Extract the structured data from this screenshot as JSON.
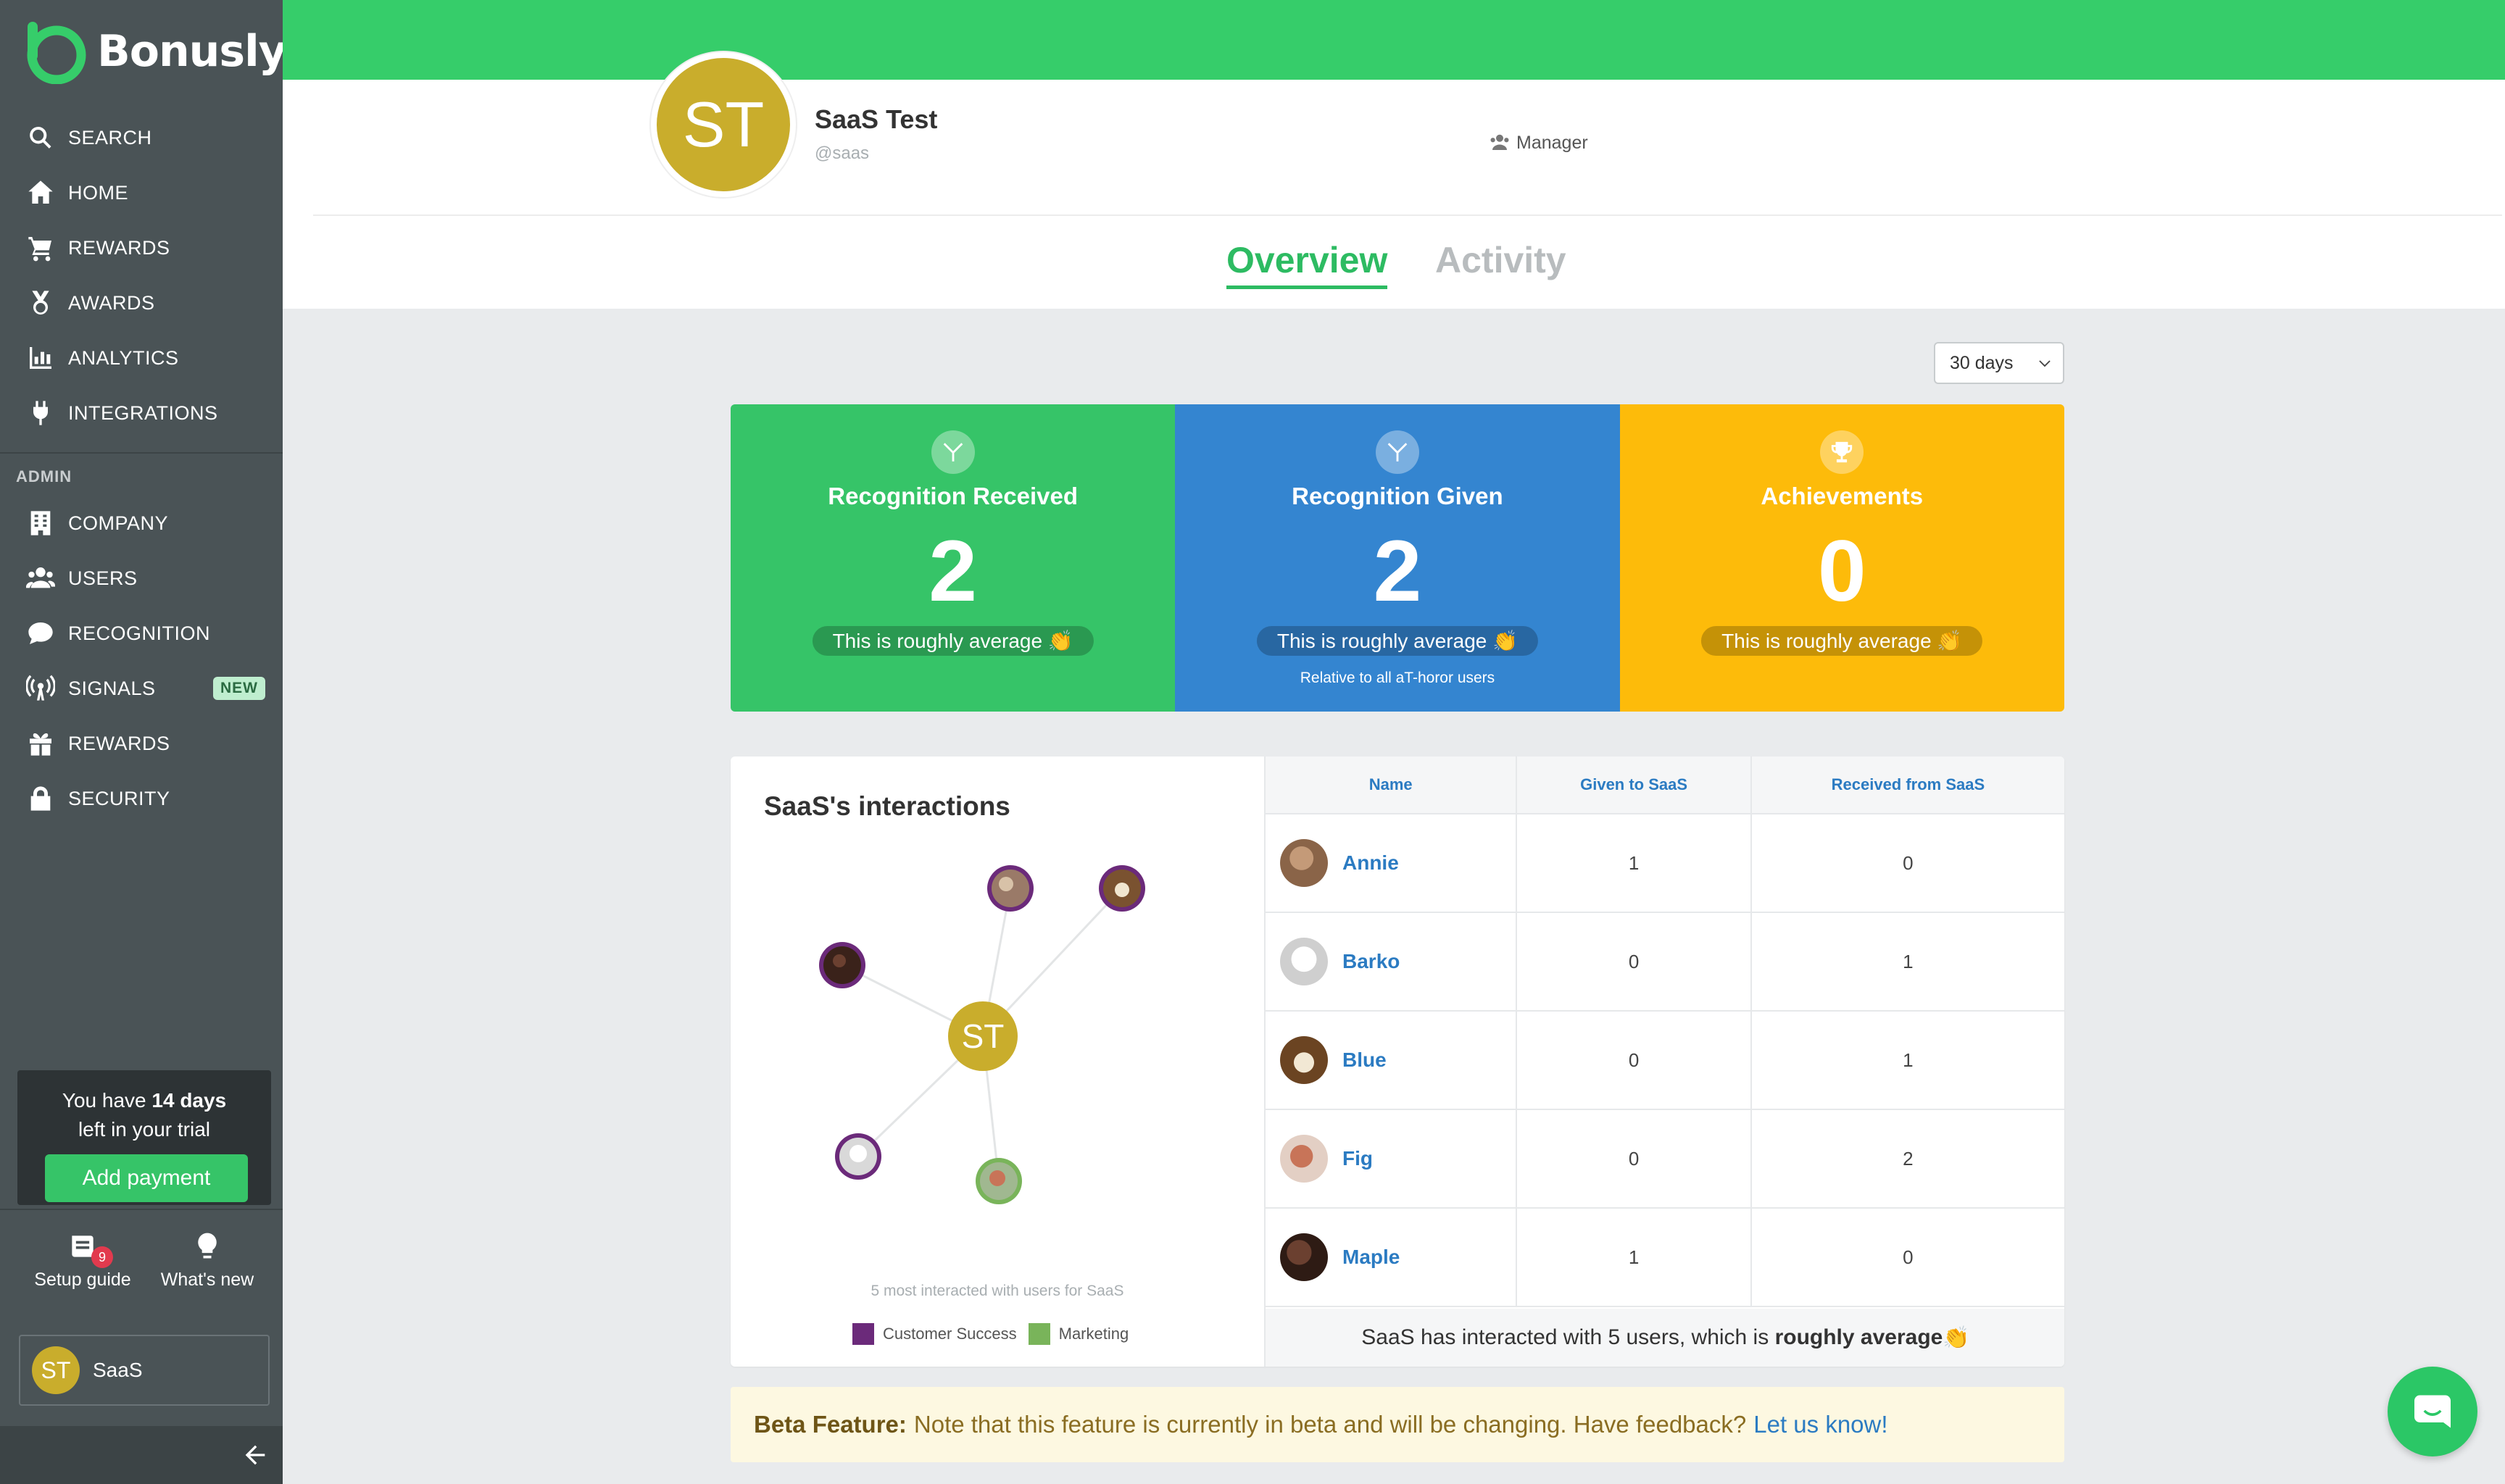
{
  "brand": {
    "name": "Bonusly",
    "color": "#36cd6a"
  },
  "nav": {
    "items": [
      {
        "label": "SEARCH",
        "icon": "search-icon"
      },
      {
        "label": "HOME",
        "icon": "home-icon"
      },
      {
        "label": "REWARDS",
        "icon": "cart-icon"
      },
      {
        "label": "AWARDS",
        "icon": "medal-icon"
      },
      {
        "label": "ANALYTICS",
        "icon": "chart-icon"
      },
      {
        "label": "INTEGRATIONS",
        "icon": "plug-icon"
      }
    ],
    "admin_label": "ADMIN",
    "admin_items": [
      {
        "label": "COMPANY",
        "icon": "building-icon"
      },
      {
        "label": "USERS",
        "icon": "users-icon"
      },
      {
        "label": "RECOGNITION",
        "icon": "comment-icon"
      },
      {
        "label": "SIGNALS",
        "icon": "signal-icon",
        "badge": "NEW"
      },
      {
        "label": "REWARDS",
        "icon": "gift-icon"
      },
      {
        "label": "SECURITY",
        "icon": "lock-icon"
      }
    ]
  },
  "trial": {
    "line1_prefix": "You have",
    "days": "14 days",
    "line2": "left in your trial",
    "button": "Add payment"
  },
  "tools": {
    "setup_guide": "Setup guide",
    "setup_badge": "9",
    "whats_new": "What's new"
  },
  "current_user": {
    "initials": "ST",
    "name": "SaaS"
  },
  "profile": {
    "initials": "ST",
    "name": "SaaS Test",
    "handle": "@saas",
    "role": "Manager"
  },
  "tabs": {
    "overview": "Overview",
    "activity": "Activity"
  },
  "range_select": {
    "value": "30 days"
  },
  "stats": [
    {
      "title": "Recognition Received",
      "value": "2",
      "pill": "This is roughly average 👏",
      "sub": ""
    },
    {
      "title": "Recognition Given",
      "value": "2",
      "pill": "This is roughly average 👏",
      "sub": "Relative to all aT-horor users"
    },
    {
      "title": "Achievements",
      "value": "0",
      "pill": "This is roughly average 👏",
      "sub": ""
    }
  ],
  "interactions": {
    "title": "SaaS's interactions",
    "center_initials": "ST",
    "caption": "5 most interacted with users for SaaS",
    "legend": [
      {
        "label": "Customer Success",
        "color": "#6b2a7a"
      },
      {
        "label": "Marketing",
        "color": "#79b45a"
      }
    ],
    "table": {
      "headers": [
        "Name",
        "Given to SaaS",
        "Received from SaaS"
      ],
      "rows": [
        {
          "name": "Annie",
          "given": "1",
          "received": "0"
        },
        {
          "name": "Barko",
          "given": "0",
          "received": "1"
        },
        {
          "name": "Blue",
          "given": "0",
          "received": "1"
        },
        {
          "name": "Fig",
          "given": "0",
          "received": "2"
        },
        {
          "name": "Maple",
          "given": "1",
          "received": "0"
        }
      ],
      "summary_prefix": "SaaS has interacted with 5 users, which is",
      "summary_bold": "roughly average",
      "summary_emoji": "👏"
    }
  },
  "beta": {
    "label": "Beta Feature:",
    "text": "Note that this feature is currently in beta and will be changing. Have feedback?",
    "link": "Let us know!"
  }
}
